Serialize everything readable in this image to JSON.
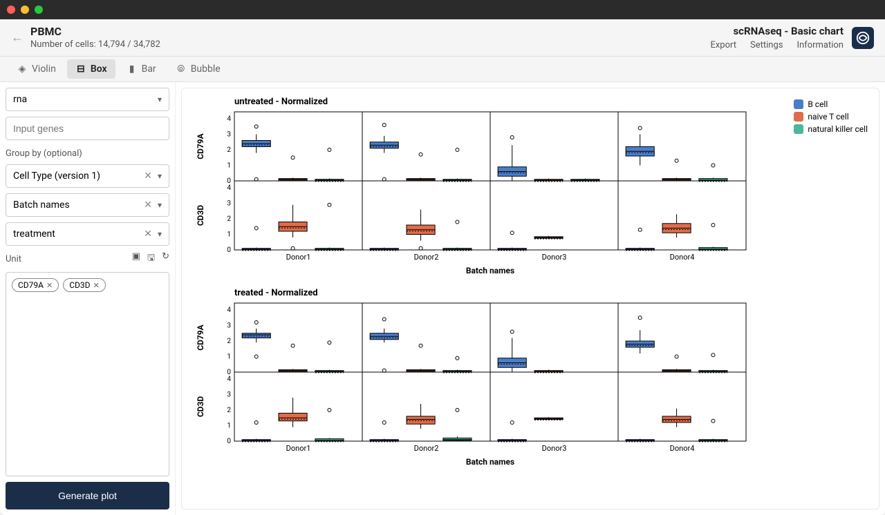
{
  "header": {
    "title": "PBMC",
    "subtitle": "Number of cells: 14,794 / 34,782",
    "right_title": "scRNAseq - Basic chart",
    "links": [
      "Export",
      "Settings",
      "Information"
    ]
  },
  "tabs": [
    {
      "label": "Violin",
      "icon": "violin-icon"
    },
    {
      "label": "Box",
      "icon": "box-icon",
      "active": true
    },
    {
      "label": "Bar",
      "icon": "bar-icon"
    },
    {
      "label": "Bubble",
      "icon": "bubble-icon"
    }
  ],
  "sidebar": {
    "source_select": "rna",
    "gene_placeholder": "Input genes",
    "group_label": "Group by (optional)",
    "groups": [
      "Cell Type (version 1)",
      "Batch names",
      "treatment"
    ],
    "unit_label": "Unit",
    "chips": [
      "CD79A",
      "CD3D"
    ],
    "generate": "Generate plot"
  },
  "legend": [
    {
      "label": "B cell",
      "color": "#4a7ec8"
    },
    {
      "label": "naive T cell",
      "color": "#e06c4a"
    },
    {
      "label": "natural killer cell",
      "color": "#4ab89a"
    }
  ],
  "chart_data": [
    {
      "title": "untreated - Normalized",
      "type": "boxplot",
      "xlabel": "Batch names",
      "ylabel_rows": [
        "CD79A",
        "CD3D"
      ],
      "categories": [
        "Donor1",
        "Donor2",
        "Donor3",
        "Donor4"
      ],
      "ylim": [
        0,
        4
      ],
      "yticks": [
        0,
        1,
        2,
        3,
        4
      ],
      "cell_types": [
        "B cell",
        "naive T cell",
        "natural killer cell"
      ],
      "colors": {
        "B cell": "#4a7ec8",
        "naive T cell": "#e06c4a",
        "natural killer cell": "#4ab89a"
      },
      "rows": {
        "CD79A": {
          "Donor1": {
            "B cell": {
              "min": 1.8,
              "q1": 2.2,
              "median": 2.4,
              "q3": 2.6,
              "max": 3.0,
              "outliers": [
                3.5,
                0.1
              ]
            },
            "naive T cell": {
              "min": 0,
              "q1": 0.05,
              "median": 0.1,
              "q3": 0.15,
              "max": 0.2,
              "outliers": [
                1.5
              ]
            },
            "natural killer cell": {
              "min": 0,
              "q1": 0,
              "median": 0.05,
              "q3": 0.1,
              "max": 0.15,
              "outliers": [
                2.0
              ]
            }
          },
          "Donor2": {
            "B cell": {
              "min": 1.8,
              "q1": 2.1,
              "median": 2.3,
              "q3": 2.5,
              "max": 2.9,
              "outliers": [
                3.6,
                0.1
              ]
            },
            "naive T cell": {
              "min": 0,
              "q1": 0.05,
              "median": 0.1,
              "q3": 0.15,
              "max": 0.2,
              "outliers": [
                1.7
              ]
            },
            "natural killer cell": {
              "min": 0,
              "q1": 0,
              "median": 0.05,
              "q3": 0.1,
              "max": 0.15,
              "outliers": [
                2.0
              ]
            }
          },
          "Donor3": {
            "B cell": {
              "min": 0,
              "q1": 0.3,
              "median": 0.6,
              "q3": 0.9,
              "max": 2.3,
              "outliers": [
                2.8
              ]
            },
            "naive T cell": {
              "min": 0,
              "q1": 0,
              "median": 0.05,
              "q3": 0.1,
              "max": 0.15,
              "outliers": []
            },
            "natural killer cell": {
              "min": 0,
              "q1": 0,
              "median": 0.05,
              "q3": 0.1,
              "max": 0.15,
              "outliers": []
            }
          },
          "Donor4": {
            "B cell": {
              "min": 1.0,
              "q1": 1.6,
              "median": 1.9,
              "q3": 2.2,
              "max": 3.0,
              "outliers": [
                3.4
              ]
            },
            "naive T cell": {
              "min": 0,
              "q1": 0.05,
              "median": 0.1,
              "q3": 0.15,
              "max": 0.2,
              "outliers": [
                1.3
              ]
            },
            "natural killer cell": {
              "min": 0,
              "q1": 0,
              "median": 0.05,
              "q3": 0.15,
              "max": 0.2,
              "outliers": [
                1.0
              ]
            }
          }
        },
        "CD3D": {
          "Donor1": {
            "B cell": {
              "min": 0,
              "q1": 0,
              "median": 0.05,
              "q3": 0.1,
              "max": 0.15,
              "outliers": [
                1.4
              ]
            },
            "naive T cell": {
              "min": 0.8,
              "q1": 1.2,
              "median": 1.5,
              "q3": 1.8,
              "max": 2.9,
              "outliers": [
                0.1
              ]
            },
            "natural killer cell": {
              "min": 0,
              "q1": 0,
              "median": 0.05,
              "q3": 0.1,
              "max": 0.15,
              "outliers": [
                2.9
              ]
            }
          },
          "Donor2": {
            "B cell": {
              "min": 0,
              "q1": 0,
              "median": 0.05,
              "q3": 0.1,
              "max": 0.15,
              "outliers": []
            },
            "naive T cell": {
              "min": 0.6,
              "q1": 1.0,
              "median": 1.3,
              "q3": 1.6,
              "max": 2.6,
              "outliers": [
                0.1
              ]
            },
            "natural killer cell": {
              "min": 0,
              "q1": 0,
              "median": 0.05,
              "q3": 0.1,
              "max": 0.15,
              "outliers": [
                1.8
              ]
            }
          },
          "Donor3": {
            "B cell": {
              "min": 0,
              "q1": 0,
              "median": 0.05,
              "q3": 0.1,
              "max": 0.15,
              "outliers": [
                1.1
              ]
            },
            "naive T cell": {
              "min": 0.7,
              "q1": 0.75,
              "median": 0.8,
              "q3": 0.85,
              "max": 0.9,
              "outliers": []
            },
            "natural killer cell": null
          },
          "Donor4": {
            "B cell": {
              "min": 0,
              "q1": 0,
              "median": 0.05,
              "q3": 0.1,
              "max": 0.15,
              "outliers": [
                1.3
              ]
            },
            "naive T cell": {
              "min": 0.8,
              "q1": 1.1,
              "median": 1.4,
              "q3": 1.7,
              "max": 2.3,
              "outliers": []
            },
            "natural killer cell": {
              "min": 0,
              "q1": 0,
              "median": 0.05,
              "q3": 0.15,
              "max": 0.2,
              "outliers": [
                1.6
              ]
            }
          }
        }
      }
    },
    {
      "title": "treated - Normalized",
      "type": "boxplot",
      "xlabel": "Batch names",
      "ylabel_rows": [
        "CD79A",
        "CD3D"
      ],
      "categories": [
        "Donor1",
        "Donor2",
        "Donor3",
        "Donor4"
      ],
      "ylim": [
        0,
        4
      ],
      "yticks": [
        0,
        1,
        2,
        3,
        4
      ],
      "cell_types": [
        "B cell",
        "naive T cell",
        "natural killer cell"
      ],
      "colors": {
        "B cell": "#4a7ec8",
        "naive T cell": "#e06c4a",
        "natural killer cell": "#4ab89a"
      },
      "rows": {
        "CD79A": {
          "Donor1": {
            "B cell": {
              "min": 1.9,
              "q1": 2.2,
              "median": 2.4,
              "q3": 2.5,
              "max": 2.8,
              "outliers": [
                3.2,
                1.0
              ]
            },
            "naive T cell": {
              "min": 0,
              "q1": 0.05,
              "median": 0.1,
              "q3": 0.15,
              "max": 0.2,
              "outliers": [
                1.7
              ]
            },
            "natural killer cell": {
              "min": 0,
              "q1": 0,
              "median": 0.05,
              "q3": 0.1,
              "max": 0.15,
              "outliers": [
                1.9
              ]
            }
          },
          "Donor2": {
            "B cell": {
              "min": 1.9,
              "q1": 2.1,
              "median": 2.3,
              "q3": 2.5,
              "max": 2.8,
              "outliers": [
                3.4,
                0.1
              ]
            },
            "naive T cell": {
              "min": 0,
              "q1": 0.05,
              "median": 0.1,
              "q3": 0.15,
              "max": 0.2,
              "outliers": [
                1.7
              ]
            },
            "natural killer cell": {
              "min": 0,
              "q1": 0,
              "median": 0.05,
              "q3": 0.1,
              "max": 0.15,
              "outliers": [
                0.9
              ]
            }
          },
          "Donor3": {
            "B cell": {
              "min": 0,
              "q1": 0.3,
              "median": 0.6,
              "q3": 0.9,
              "max": 2.2,
              "outliers": [
                2.6
              ]
            },
            "naive T cell": {
              "min": 0,
              "q1": 0,
              "median": 0.05,
              "q3": 0.1,
              "max": 0.15,
              "outliers": []
            },
            "natural killer cell": null
          },
          "Donor4": {
            "B cell": {
              "min": 1.2,
              "q1": 1.6,
              "median": 1.8,
              "q3": 2.0,
              "max": 2.7,
              "outliers": [
                3.5
              ]
            },
            "naive T cell": {
              "min": 0,
              "q1": 0.05,
              "median": 0.1,
              "q3": 0.15,
              "max": 0.2,
              "outliers": [
                1.0
              ]
            },
            "natural killer cell": {
              "min": 0,
              "q1": 0,
              "median": 0.05,
              "q3": 0.1,
              "max": 0.15,
              "outliers": [
                1.1
              ]
            }
          }
        },
        "CD3D": {
          "Donor1": {
            "B cell": {
              "min": 0,
              "q1": 0,
              "median": 0.05,
              "q3": 0.1,
              "max": 0.15,
              "outliers": [
                1.2
              ]
            },
            "naive T cell": {
              "min": 0.9,
              "q1": 1.3,
              "median": 1.5,
              "q3": 1.8,
              "max": 2.8,
              "outliers": []
            },
            "natural killer cell": {
              "min": 0,
              "q1": 0,
              "median": 0.05,
              "q3": 0.15,
              "max": 0.2,
              "outliers": [
                2.0
              ]
            }
          },
          "Donor2": {
            "B cell": {
              "min": 0,
              "q1": 0,
              "median": 0.05,
              "q3": 0.1,
              "max": 0.15,
              "outliers": [
                1.2
              ]
            },
            "naive T cell": {
              "min": 0.8,
              "q1": 1.1,
              "median": 1.4,
              "q3": 1.6,
              "max": 2.4,
              "outliers": []
            },
            "natural killer cell": {
              "min": 0,
              "q1": 0.05,
              "median": 0.1,
              "q3": 0.2,
              "max": 0.3,
              "outliers": [
                2.0
              ]
            }
          },
          "Donor3": {
            "B cell": {
              "min": 0,
              "q1": 0,
              "median": 0.05,
              "q3": 0.1,
              "max": 0.15,
              "outliers": [
                1.2
              ]
            },
            "naive T cell": {
              "min": 1.35,
              "q1": 1.4,
              "median": 1.45,
              "q3": 1.5,
              "max": 1.55,
              "outliers": []
            },
            "natural killer cell": null
          },
          "Donor4": {
            "B cell": {
              "min": 0,
              "q1": 0,
              "median": 0.05,
              "q3": 0.1,
              "max": 0.15,
              "outliers": []
            },
            "naive T cell": {
              "min": 0.9,
              "q1": 1.2,
              "median": 1.4,
              "q3": 1.6,
              "max": 2.1,
              "outliers": []
            },
            "natural killer cell": {
              "min": 0,
              "q1": 0,
              "median": 0.05,
              "q3": 0.1,
              "max": 0.15,
              "outliers": [
                1.3
              ]
            }
          }
        }
      }
    }
  ]
}
